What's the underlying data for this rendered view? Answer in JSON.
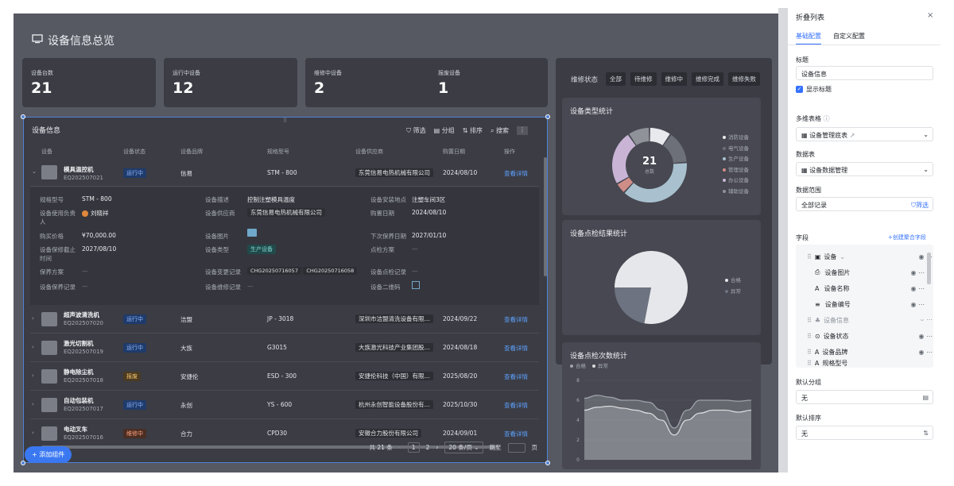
{
  "header": {
    "title": "设备信息总览"
  },
  "kpis": [
    {
      "label": "设备台数",
      "value": "21"
    },
    {
      "label": "运行中设备",
      "value": "12"
    },
    {
      "label": "维修中设备",
      "value": "2"
    },
    {
      "label": "报废设备",
      "value": "1"
    }
  ],
  "table": {
    "title": "设备信息",
    "tools": [
      "筛选",
      "分组",
      "排序",
      "搜索"
    ],
    "columns": [
      "设备",
      "设备状态",
      "设备品牌",
      "规格型号",
      "设备供应商",
      "购置日期",
      "操作"
    ],
    "rows": [
      {
        "name": "模具温控机",
        "code": "EQ202507021",
        "status": "运行中",
        "brand": "信易",
        "model": "STM - 800",
        "supplier": "东莞信易电热机械有限公司",
        "date": "2024/08/10",
        "action": "查看详情"
      },
      {
        "name": "超声波清洗机",
        "code": "EQ202507020",
        "status": "运行中",
        "brand": "洁盟",
        "model": "JP - 3018",
        "supplier": "深圳市洁盟清洗设备有限...",
        "date": "2024/09/22",
        "action": "查看详情"
      },
      {
        "name": "激光切割机",
        "code": "EQ202507019",
        "status": "运行中",
        "brand": "大族",
        "model": "G3015",
        "supplier": "大族激光科技产业集团股...",
        "date": "2024/08/18",
        "action": "查看详情"
      },
      {
        "name": "静电除尘机",
        "code": "EQ202507018",
        "status": "报废",
        "brand": "安捷伦",
        "model": "ESD - 300",
        "supplier": "安捷伦科技（中国）有限...",
        "date": "2025/08/20",
        "action": "查看详情"
      },
      {
        "name": "自动包装机",
        "code": "EQ202507017",
        "status": "运行中",
        "brand": "永创",
        "model": "YS - 600",
        "supplier": "杭州永创智能设备股份有...",
        "date": "2025/10/30",
        "action": "查看详情"
      },
      {
        "name": "电动叉车",
        "code": "EQ202507016",
        "status": "维修中",
        "brand": "合力",
        "model": "CPD30",
        "supplier": "安徽合力股份有限公司",
        "date": "2024/09/01",
        "action": "查看详情"
      }
    ],
    "detail": {
      "model_label": "规格型号",
      "model": "STM - 800",
      "desc_label": "设备描述",
      "desc": "控制注塑模具温度",
      "loc_label": "设备安装地点",
      "loc": "注塑车间3区",
      "owner_label": "设备使用负责人",
      "owner": "刘晓祥",
      "supplier_label": "设备供应商",
      "supplier": "东莞信易电热机械有限公司",
      "buydate_label": "购置日期",
      "buydate": "2024/08/10",
      "price_label": "购买价格",
      "price": "¥70,000.00",
      "img_label": "设备图片",
      "nextmaint_label": "下次保养日期",
      "nextmaint": "2027/01/10",
      "warranty_label": "设备保修截止时间",
      "warranty": "2027/08/10",
      "type_label": "设备类型",
      "type": "生产设备",
      "inspect_label": "点检方案",
      "inspect": "—",
      "maintplan_label": "保养方案",
      "maintplan": "—",
      "change_label": "设备变更记录",
      "change1": "CHG20250716057",
      "change2": "CHG20250716058",
      "inspectrec_label": "设备点检记录",
      "inspectrec": "—",
      "maintrec_label": "设备保养记录",
      "maintrec": "—",
      "repair_label": "设备维修记录",
      "repair": "—",
      "qr_label": "设备二维码"
    },
    "pager": {
      "total": "共 21 条",
      "page1": "1",
      "page2": "2",
      "size": "20 条/页",
      "goto": "跳至",
      "unit": "页"
    }
  },
  "add_button": "+ 添加组件",
  "repair_tabs": {
    "label": "维修状态",
    "items": [
      "全部",
      "待维修",
      "维修中",
      "维修完成",
      "维修失败"
    ]
  },
  "type_chart": {
    "title": "设备类型统计",
    "center_value": "21",
    "center_label": "总数"
  },
  "result_chart": {
    "title": "设备点检结果统计"
  },
  "count_chart": {
    "title": "设备点检次数统计"
  },
  "chart_data": [
    {
      "type": "pie",
      "title": "设备类型统计",
      "categories": [
        "消防设备",
        "电气设备",
        "生产设备",
        "管理设备",
        "办公设备",
        "辅助设备"
      ],
      "values": [
        2,
        3,
        8,
        1,
        5,
        2
      ],
      "colors": [
        "#e8e9ec",
        "#6d7079",
        "#a9c1cf",
        "#cf8d88",
        "#c9b4d6",
        "#8f9299"
      ]
    },
    {
      "type": "pie",
      "title": "设备点检结果统计",
      "categories": [
        "合格",
        "异常"
      ],
      "values": [
        78,
        22
      ],
      "colors": [
        "#e6e7ea",
        "#6d7380"
      ]
    },
    {
      "type": "area",
      "title": "设备点检次数统计",
      "ylim": [
        0,
        8
      ],
      "yticks": [
        "0",
        "2",
        "4",
        "6",
        "8"
      ],
      "series": [
        {
          "name": "合格",
          "values": [
            6.2,
            6.5,
            6.3,
            6.0,
            6.0,
            5.8,
            5.0,
            3.2,
            5.0,
            6.0,
            6.0,
            6.0,
            5.9,
            6.0
          ]
        },
        {
          "name": "异常",
          "values": [
            5.0,
            5.3,
            5.4,
            5.2,
            5.0,
            4.7,
            4.0,
            2.5,
            4.0,
            4.7,
            5.0,
            5.0,
            4.8,
            5.0
          ]
        }
      ],
      "colors": [
        "#9ea2aa",
        "#d9dadd"
      ]
    }
  ],
  "sidebar": {
    "title": "折叠列表",
    "tabs": [
      "基础配置",
      "自定义配置"
    ],
    "title_label": "标题",
    "title_value": "设备信息",
    "show_title": "显示标题",
    "multi_label": "多维表格",
    "multi_value": "设备管理底表",
    "source_label": "数据表",
    "source_value": "设备数据管理",
    "range_label": "数据范围",
    "range_value": "全部记录",
    "range_filter": "筛选",
    "fields_label": "字段",
    "fields_add": "+创建聚合字段",
    "fields": [
      "设备",
      "设备图片",
      "设备名称",
      "设备编号",
      "设备信息",
      "设备状态",
      "设备品牌",
      "规格型号"
    ],
    "group_label": "默认分组",
    "group_value": "无",
    "sort_label": "默认排序",
    "sort_value": "无"
  }
}
